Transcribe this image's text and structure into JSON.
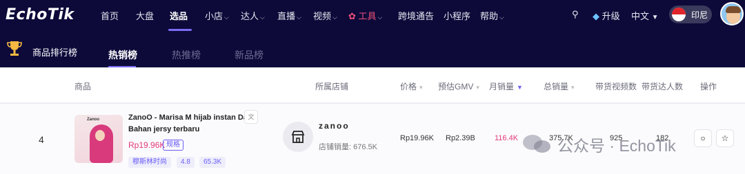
{
  "logo": "EchoTik",
  "nav": {
    "items": [
      "首页",
      "大盘",
      "选品",
      "小店",
      "达人",
      "直播",
      "视频",
      "工具",
      "跨境通告",
      "小程序",
      "帮助"
    ],
    "upgrade": "升级",
    "language": "中文",
    "region": "印尼"
  },
  "subnav": {
    "title": "商品排行榜",
    "tabs": [
      "热销榜",
      "热推榜",
      "新品榜"
    ]
  },
  "table": {
    "headers": {
      "product": "商品",
      "shop": "所属店铺",
      "price": "价格",
      "gmv": "预估GMV",
      "monthly_sales": "月销量",
      "total_sales": "总销量",
      "videos": "带货视频数",
      "creators": "带货达人数",
      "actions": "操作"
    },
    "row": {
      "rank": "4",
      "title": "ZanoO - Marisa M hijab instan Daily Bahan jersy terbaru",
      "image_brand": "Zanoo",
      "price_display": "Rp19.96K",
      "spec_label": "规格",
      "tags": [
        "穆斯林时尚",
        "4.8",
        "65.3K"
      ],
      "shop_name": "zanoo",
      "shop_sales": "店铺销量: 676.5K",
      "price": "Rp19.96K",
      "gmv": "Rp2.39B",
      "monthly_sales": "116.4K",
      "total_sales": "375.7K",
      "videos": "925",
      "creators": "182"
    }
  },
  "watermark": "公众号 · EchoTik",
  "colors": {
    "nav_bg": "#0d0a3a",
    "accent": "#6a5cf6",
    "pink": "#e2397a"
  }
}
